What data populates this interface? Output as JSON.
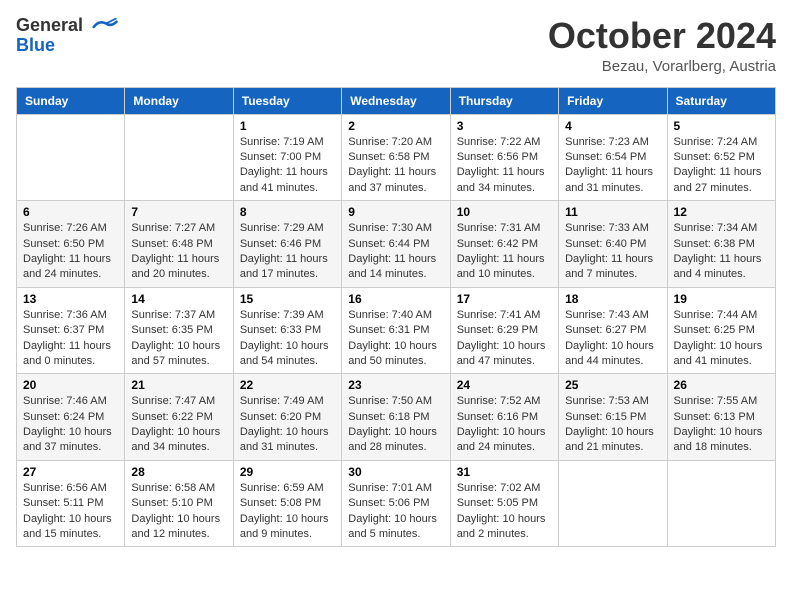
{
  "header": {
    "logo_general": "General",
    "logo_blue": "Blue",
    "title": "October 2024",
    "location": "Bezau, Vorarlberg, Austria"
  },
  "days_of_week": [
    "Sunday",
    "Monday",
    "Tuesday",
    "Wednesday",
    "Thursday",
    "Friday",
    "Saturday"
  ],
  "weeks": [
    [
      {
        "day": "",
        "sunrise": "",
        "sunset": "",
        "daylight": "",
        "empty": true
      },
      {
        "day": "",
        "sunrise": "",
        "sunset": "",
        "daylight": "",
        "empty": true
      },
      {
        "day": "1",
        "sunrise": "Sunrise: 7:19 AM",
        "sunset": "Sunset: 7:00 PM",
        "daylight": "Daylight: 11 hours and 41 minutes."
      },
      {
        "day": "2",
        "sunrise": "Sunrise: 7:20 AM",
        "sunset": "Sunset: 6:58 PM",
        "daylight": "Daylight: 11 hours and 37 minutes."
      },
      {
        "day": "3",
        "sunrise": "Sunrise: 7:22 AM",
        "sunset": "Sunset: 6:56 PM",
        "daylight": "Daylight: 11 hours and 34 minutes."
      },
      {
        "day": "4",
        "sunrise": "Sunrise: 7:23 AM",
        "sunset": "Sunset: 6:54 PM",
        "daylight": "Daylight: 11 hours and 31 minutes."
      },
      {
        "day": "5",
        "sunrise": "Sunrise: 7:24 AM",
        "sunset": "Sunset: 6:52 PM",
        "daylight": "Daylight: 11 hours and 27 minutes."
      }
    ],
    [
      {
        "day": "6",
        "sunrise": "Sunrise: 7:26 AM",
        "sunset": "Sunset: 6:50 PM",
        "daylight": "Daylight: 11 hours and 24 minutes."
      },
      {
        "day": "7",
        "sunrise": "Sunrise: 7:27 AM",
        "sunset": "Sunset: 6:48 PM",
        "daylight": "Daylight: 11 hours and 20 minutes."
      },
      {
        "day": "8",
        "sunrise": "Sunrise: 7:29 AM",
        "sunset": "Sunset: 6:46 PM",
        "daylight": "Daylight: 11 hours and 17 minutes."
      },
      {
        "day": "9",
        "sunrise": "Sunrise: 7:30 AM",
        "sunset": "Sunset: 6:44 PM",
        "daylight": "Daylight: 11 hours and 14 minutes."
      },
      {
        "day": "10",
        "sunrise": "Sunrise: 7:31 AM",
        "sunset": "Sunset: 6:42 PM",
        "daylight": "Daylight: 11 hours and 10 minutes."
      },
      {
        "day": "11",
        "sunrise": "Sunrise: 7:33 AM",
        "sunset": "Sunset: 6:40 PM",
        "daylight": "Daylight: 11 hours and 7 minutes."
      },
      {
        "day": "12",
        "sunrise": "Sunrise: 7:34 AM",
        "sunset": "Sunset: 6:38 PM",
        "daylight": "Daylight: 11 hours and 4 minutes."
      }
    ],
    [
      {
        "day": "13",
        "sunrise": "Sunrise: 7:36 AM",
        "sunset": "Sunset: 6:37 PM",
        "daylight": "Daylight: 11 hours and 0 minutes."
      },
      {
        "day": "14",
        "sunrise": "Sunrise: 7:37 AM",
        "sunset": "Sunset: 6:35 PM",
        "daylight": "Daylight: 10 hours and 57 minutes."
      },
      {
        "day": "15",
        "sunrise": "Sunrise: 7:39 AM",
        "sunset": "Sunset: 6:33 PM",
        "daylight": "Daylight: 10 hours and 54 minutes."
      },
      {
        "day": "16",
        "sunrise": "Sunrise: 7:40 AM",
        "sunset": "Sunset: 6:31 PM",
        "daylight": "Daylight: 10 hours and 50 minutes."
      },
      {
        "day": "17",
        "sunrise": "Sunrise: 7:41 AM",
        "sunset": "Sunset: 6:29 PM",
        "daylight": "Daylight: 10 hours and 47 minutes."
      },
      {
        "day": "18",
        "sunrise": "Sunrise: 7:43 AM",
        "sunset": "Sunset: 6:27 PM",
        "daylight": "Daylight: 10 hours and 44 minutes."
      },
      {
        "day": "19",
        "sunrise": "Sunrise: 7:44 AM",
        "sunset": "Sunset: 6:25 PM",
        "daylight": "Daylight: 10 hours and 41 minutes."
      }
    ],
    [
      {
        "day": "20",
        "sunrise": "Sunrise: 7:46 AM",
        "sunset": "Sunset: 6:24 PM",
        "daylight": "Daylight: 10 hours and 37 minutes."
      },
      {
        "day": "21",
        "sunrise": "Sunrise: 7:47 AM",
        "sunset": "Sunset: 6:22 PM",
        "daylight": "Daylight: 10 hours and 34 minutes."
      },
      {
        "day": "22",
        "sunrise": "Sunrise: 7:49 AM",
        "sunset": "Sunset: 6:20 PM",
        "daylight": "Daylight: 10 hours and 31 minutes."
      },
      {
        "day": "23",
        "sunrise": "Sunrise: 7:50 AM",
        "sunset": "Sunset: 6:18 PM",
        "daylight": "Daylight: 10 hours and 28 minutes."
      },
      {
        "day": "24",
        "sunrise": "Sunrise: 7:52 AM",
        "sunset": "Sunset: 6:16 PM",
        "daylight": "Daylight: 10 hours and 24 minutes."
      },
      {
        "day": "25",
        "sunrise": "Sunrise: 7:53 AM",
        "sunset": "Sunset: 6:15 PM",
        "daylight": "Daylight: 10 hours and 21 minutes."
      },
      {
        "day": "26",
        "sunrise": "Sunrise: 7:55 AM",
        "sunset": "Sunset: 6:13 PM",
        "daylight": "Daylight: 10 hours and 18 minutes."
      }
    ],
    [
      {
        "day": "27",
        "sunrise": "Sunrise: 6:56 AM",
        "sunset": "Sunset: 5:11 PM",
        "daylight": "Daylight: 10 hours and 15 minutes."
      },
      {
        "day": "28",
        "sunrise": "Sunrise: 6:58 AM",
        "sunset": "Sunset: 5:10 PM",
        "daylight": "Daylight: 10 hours and 12 minutes."
      },
      {
        "day": "29",
        "sunrise": "Sunrise: 6:59 AM",
        "sunset": "Sunset: 5:08 PM",
        "daylight": "Daylight: 10 hours and 9 minutes."
      },
      {
        "day": "30",
        "sunrise": "Sunrise: 7:01 AM",
        "sunset": "Sunset: 5:06 PM",
        "daylight": "Daylight: 10 hours and 5 minutes."
      },
      {
        "day": "31",
        "sunrise": "Sunrise: 7:02 AM",
        "sunset": "Sunset: 5:05 PM",
        "daylight": "Daylight: 10 hours and 2 minutes."
      },
      {
        "day": "",
        "sunrise": "",
        "sunset": "",
        "daylight": "",
        "empty": true
      },
      {
        "day": "",
        "sunrise": "",
        "sunset": "",
        "daylight": "",
        "empty": true
      }
    ]
  ]
}
